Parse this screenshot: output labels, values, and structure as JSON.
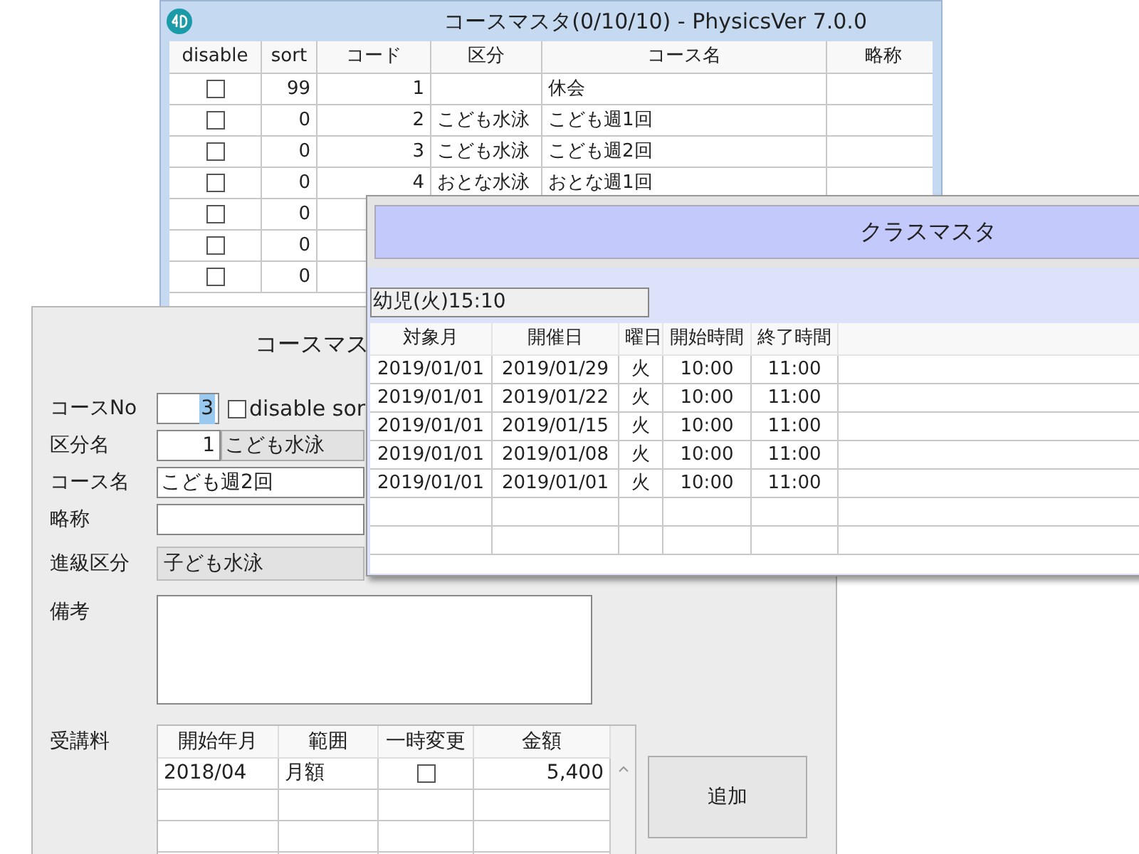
{
  "course_list_window": {
    "title": "コースマスタ(0/10/10) - PhysicsVer 7.0.0",
    "columns": [
      "disable",
      "sort",
      "コード",
      "区分",
      "コース名",
      "略称"
    ],
    "rows": [
      {
        "checked": false,
        "sort": "99",
        "code": "1",
        "name": "休会"
      },
      {
        "checked": false,
        "sort": "0",
        "code": "2",
        "category": "こども水泳",
        "name": "こども週1回"
      },
      {
        "checked": false,
        "sort": "0",
        "code": "3",
        "category": "こども水泳",
        "name": "こども週2回"
      },
      {
        "checked": false,
        "sort": "0",
        "code": "4",
        "category": "おとな水泳",
        "name": "おとな週1回"
      },
      {
        "checked": false,
        "sort": "0"
      },
      {
        "checked": false,
        "sort": "0"
      },
      {
        "checked": false,
        "sort": "0"
      }
    ]
  },
  "course_form": {
    "title": "コースマス",
    "course_no": {
      "label": "コースNo",
      "value": "3",
      "highlighted": true
    },
    "disable_checkbox": {
      "label": "disable sor",
      "checked": false
    },
    "category": {
      "label": "区分名",
      "code": "1",
      "value": "こども水泳"
    },
    "course_name": {
      "label": "コース名",
      "value": "こども週2回"
    },
    "short_name": {
      "label": "略称"
    },
    "level_category": {
      "label": "進級区分",
      "value": "子ども水泳"
    },
    "notes": {
      "label": "備考"
    },
    "fees": {
      "label": "受講料",
      "columns": [
        "開始年月",
        "範囲",
        "一時変更",
        "金額"
      ],
      "rows": [
        {
          "start": "2018/04",
          "range": "月額",
          "temporary": false,
          "amount": "5,400"
        }
      ]
    },
    "add_button": "追加"
  },
  "class_window": {
    "title": "クラスマスタ",
    "class_field": "幼児(火)15:10",
    "columns": [
      "対象月",
      "開催日",
      "曜日",
      "開始時間",
      "終了時間"
    ],
    "rows": [
      {
        "month": "2019/01/01",
        "date": "2019/01/29",
        "weekday": "火",
        "start": "10:00",
        "end": "11:00"
      },
      {
        "month": "2019/01/01",
        "date": "2019/01/22",
        "weekday": "火",
        "start": "10:00",
        "end": "11:00"
      },
      {
        "month": "2019/01/01",
        "date": "2019/01/15",
        "weekday": "火",
        "start": "10:00",
        "end": "11:00"
      },
      {
        "month": "2019/01/01",
        "date": "2019/01/08",
        "weekday": "火",
        "start": "10:00",
        "end": "11:00"
      },
      {
        "month": "2019/01/01",
        "date": "2019/01/01",
        "weekday": "火",
        "start": "10:00",
        "end": "11:00"
      }
    ]
  }
}
